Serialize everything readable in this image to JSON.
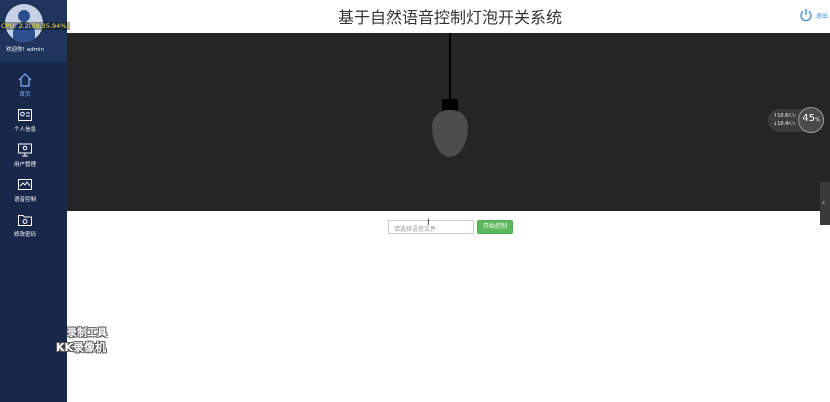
{
  "header": {
    "title": "基于自然语音控制灯泡开关系统",
    "logout_label": "退出"
  },
  "user": {
    "welcome_label": "欢迎你!",
    "username": "admin",
    "overlay": "CPU: 2.2(59.35.94%)"
  },
  "sidebar": {
    "items": [
      {
        "label": "首页",
        "icon": "home-icon",
        "active": true
      },
      {
        "label": "个人信息",
        "icon": "profile-icon",
        "active": false
      },
      {
        "label": "用户管理",
        "icon": "user-manage-icon",
        "active": false
      },
      {
        "label": "语音控制",
        "icon": "voice-control-icon",
        "active": false
      },
      {
        "label": "修改密码",
        "icon": "password-icon",
        "active": false
      }
    ]
  },
  "watermark": {
    "line1": "录制工具",
    "line2": "KK录像机"
  },
  "net_monitor": {
    "upload": "10.6",
    "upload_unit": "K/s",
    "download": "10.4",
    "download_unit": "K/s",
    "percent": "45",
    "percent_unit": "%"
  },
  "controls": {
    "file_placeholder": "请选择语音文件",
    "start_button": "开始控制"
  },
  "colors": {
    "sidebar_bg": "#18274a",
    "stage_bg": "#252525",
    "bulb_off": "#4d4d4d",
    "button_green": "#5cb85c",
    "accent_blue": "#3b8ad9"
  }
}
